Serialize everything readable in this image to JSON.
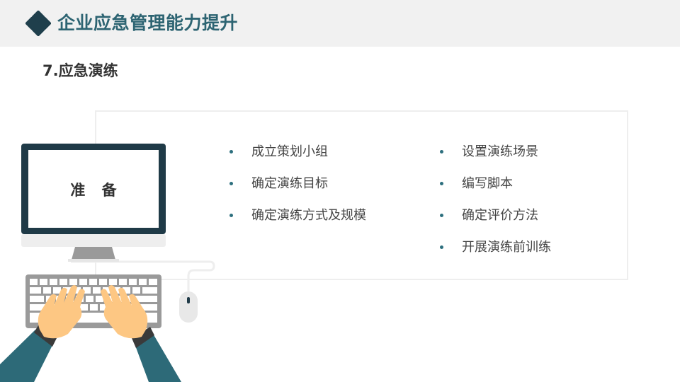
{
  "header": {
    "title": "企业应急管理能力提升",
    "logo_icon": "diamond-grid-icon",
    "accent_color": "#2d6472"
  },
  "section": {
    "title": "7.应急演练"
  },
  "illustration": {
    "monitor_label": "准 备"
  },
  "lists": {
    "left": [
      {
        "text": "成立策划小组"
      },
      {
        "text": "确定演练目标"
      },
      {
        "text": "确定演练方式及规模"
      }
    ],
    "right": [
      {
        "text": "设置演练场景"
      },
      {
        "text": "编写脚本"
      },
      {
        "text": "确定评价方法"
      },
      {
        "text": "开展演练前训练"
      }
    ]
  }
}
